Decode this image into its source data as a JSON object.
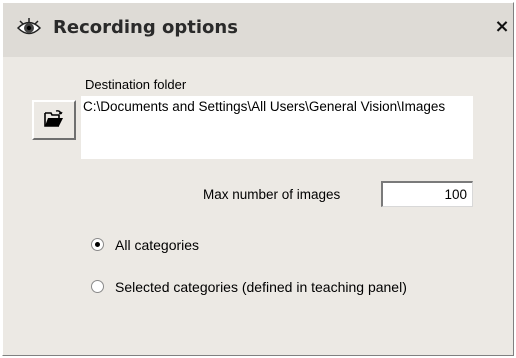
{
  "dialog": {
    "title": "Recording options",
    "title_icon": "eye-icon",
    "close_label": "×"
  },
  "destination": {
    "label": "Destination folder",
    "path": "C:\\Documents and Settings\\All Users\\General Vision\\Images",
    "browse_icon": "open-folder-icon"
  },
  "max_images": {
    "label": "Max number of images",
    "value": "100"
  },
  "categories": {
    "options": [
      {
        "label": "All categories",
        "selected": true
      },
      {
        "label": "Selected categories (defined in teaching panel)",
        "selected": false
      }
    ]
  },
  "colors": {
    "dialog_bg": "#ece9e4",
    "titlebar_bg": "#dedbd6"
  }
}
